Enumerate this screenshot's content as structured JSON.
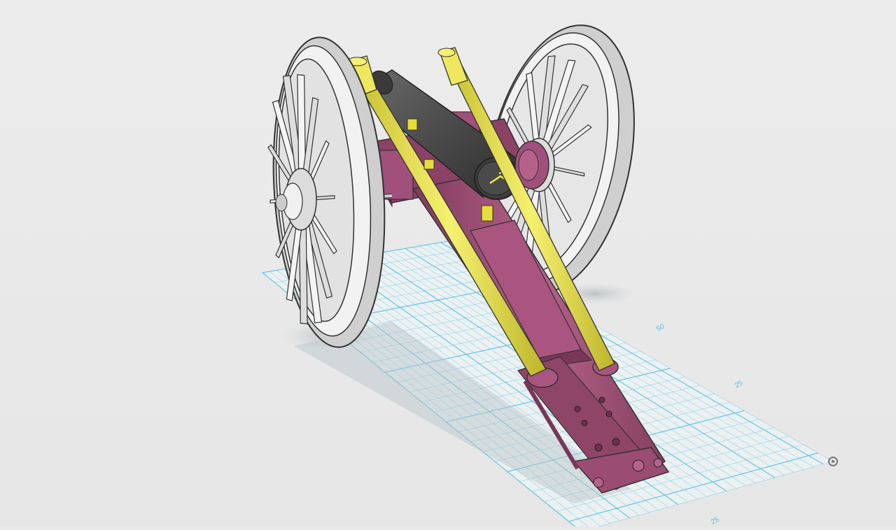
{
  "viewport": {
    "background": "#e9e9e9",
    "grid_color": "#57c1e6",
    "grid_labels": [
      "50",
      "25",
      "25"
    ]
  },
  "model": {
    "wheel_color": "#f2f2f2",
    "carriage_color": "#9c4a72",
    "shaft_color": "#efe85e",
    "barrel_color": "#4a4a4a"
  },
  "icons": {
    "origin_marker": "origin-ring-icon"
  }
}
